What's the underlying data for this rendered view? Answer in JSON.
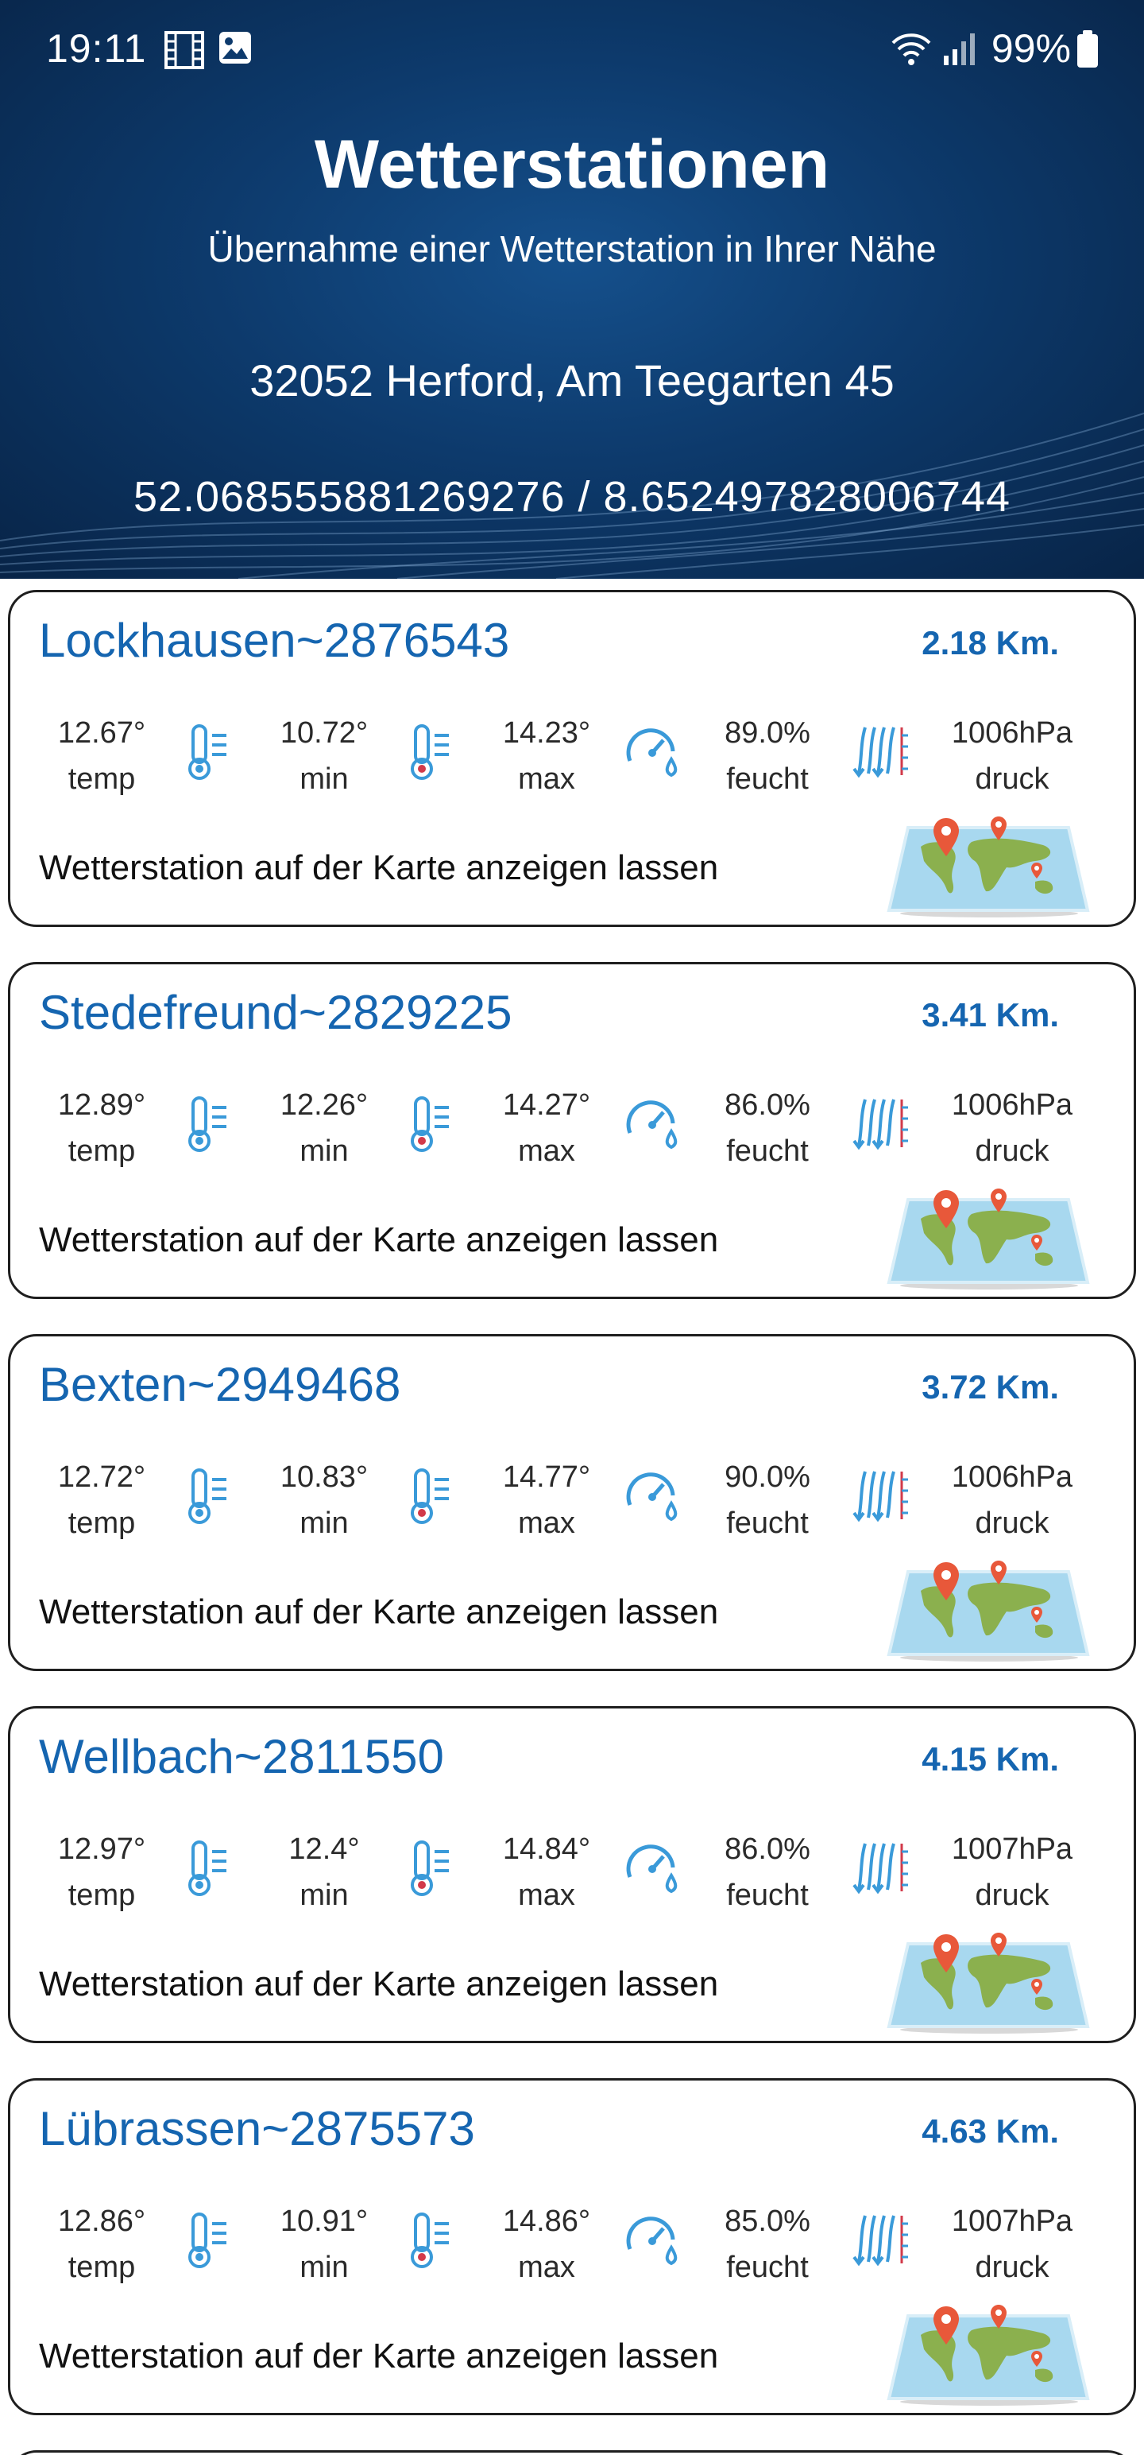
{
  "status_bar": {
    "time": "19:11",
    "battery": "99%",
    "icons": [
      "film-icon",
      "image-icon",
      "wifi-icon",
      "signal-icon",
      "battery-icon"
    ]
  },
  "header": {
    "title": "Wetterstationen",
    "subtitle": "Übernahme einer Wetterstation in Ihrer Nähe",
    "address": "32052 Herford, Am Teegarten 45",
    "coordinates": "52.068555881269276 / 8.652497828006744"
  },
  "colors": {
    "accent": "#1565b0",
    "icon": "#3a9ad9",
    "header_bg": "#0d3a6c"
  },
  "stations": [
    {
      "name": "Lockhausen~2876543",
      "distance": "2.18 Km.",
      "temp": "12.67°",
      "temp_label": "temp",
      "min": "10.72°",
      "min_label": "min",
      "max": "14.23°",
      "max_label": "max",
      "humidity": "89.0%",
      "humidity_label": "feucht",
      "pressure": "1006hPa",
      "pressure_label": "druck",
      "map_link": "Wetterstation auf der Karte anzeigen lassen"
    },
    {
      "name": "Stedefreund~2829225",
      "distance": "3.41 Km.",
      "temp": "12.89°",
      "temp_label": "temp",
      "min": "12.26°",
      "min_label": "min",
      "max": "14.27°",
      "max_label": "max",
      "humidity": "86.0%",
      "humidity_label": "feucht",
      "pressure": "1006hPa",
      "pressure_label": "druck",
      "map_link": "Wetterstation auf der Karte anzeigen lassen"
    },
    {
      "name": "Bexten~2949468",
      "distance": "3.72 Km.",
      "temp": "12.72°",
      "temp_label": "temp",
      "min": "10.83°",
      "min_label": "min",
      "max": "14.77°",
      "max_label": "max",
      "humidity": "90.0%",
      "humidity_label": "feucht",
      "pressure": "1006hPa",
      "pressure_label": "druck",
      "map_link": "Wetterstation auf der Karte anzeigen lassen"
    },
    {
      "name": "Wellbach~2811550",
      "distance": "4.15 Km.",
      "temp": "12.97°",
      "temp_label": "temp",
      "min": "12.4°",
      "min_label": "min",
      "max": "14.84°",
      "max_label": "max",
      "humidity": "86.0%",
      "humidity_label": "feucht",
      "pressure": "1007hPa",
      "pressure_label": "druck",
      "map_link": "Wetterstation auf der Karte anzeigen lassen"
    },
    {
      "name": "Lübrassen~2875573",
      "distance": "4.63 Km.",
      "temp": "12.86°",
      "temp_label": "temp",
      "min": "10.91°",
      "min_label": "min",
      "max": "14.86°",
      "max_label": "max",
      "humidity": "85.0%",
      "humidity_label": "feucht",
      "pressure": "1007hPa",
      "pressure_label": "druck",
      "map_link": "Wetterstation auf der Karte anzeigen lassen"
    }
  ]
}
